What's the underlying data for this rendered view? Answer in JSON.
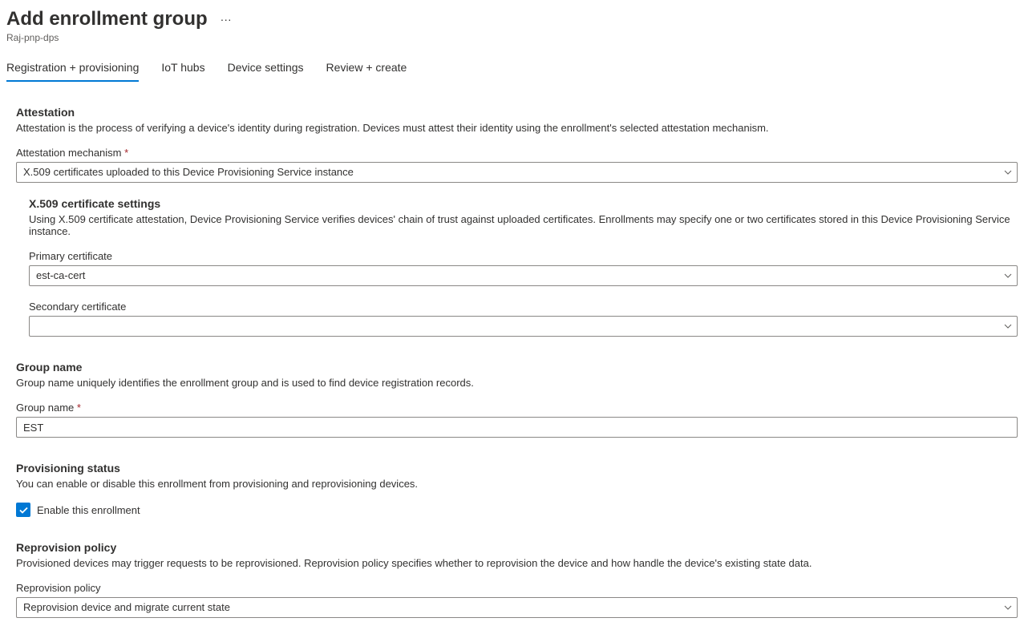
{
  "header": {
    "title": "Add enrollment group",
    "subtitle": "Raj-pnp-dps",
    "more_label": "···"
  },
  "tabs": [
    {
      "label": "Registration + provisioning",
      "active": true
    },
    {
      "label": "IoT hubs",
      "active": false
    },
    {
      "label": "Device settings",
      "active": false
    },
    {
      "label": "Review + create",
      "active": false
    }
  ],
  "attestation": {
    "title": "Attestation",
    "desc": "Attestation is the process of verifying a device's identity during registration. Devices must attest their identity using the enrollment's selected attestation mechanism.",
    "mechanism_label": "Attestation mechanism",
    "mechanism_value": "X.509 certificates uploaded to this Device Provisioning Service instance",
    "x509": {
      "title": "X.509 certificate settings",
      "desc": "Using X.509 certificate attestation, Device Provisioning Service verifies devices' chain of trust against uploaded certificates. Enrollments may specify one or two certificates stored in this Device Provisioning Service instance.",
      "primary_label": "Primary certificate",
      "primary_value": "est-ca-cert",
      "secondary_label": "Secondary certificate",
      "secondary_value": ""
    }
  },
  "groupname": {
    "title": "Group name",
    "desc": "Group name uniquely identifies the enrollment group and is used to find device registration records.",
    "label": "Group name",
    "value": "EST"
  },
  "provisioning": {
    "title": "Provisioning status",
    "desc": "You can enable or disable this enrollment from provisioning and reprovisioning devices.",
    "checkbox_label": "Enable this enrollment",
    "checked": true
  },
  "reprovision": {
    "title": "Reprovision policy",
    "desc": "Provisioned devices may trigger requests to be reprovisioned. Reprovision policy specifies whether to reprovision the device and how handle the device's existing state data.",
    "label": "Reprovision policy",
    "value": "Reprovision device and migrate current state"
  }
}
